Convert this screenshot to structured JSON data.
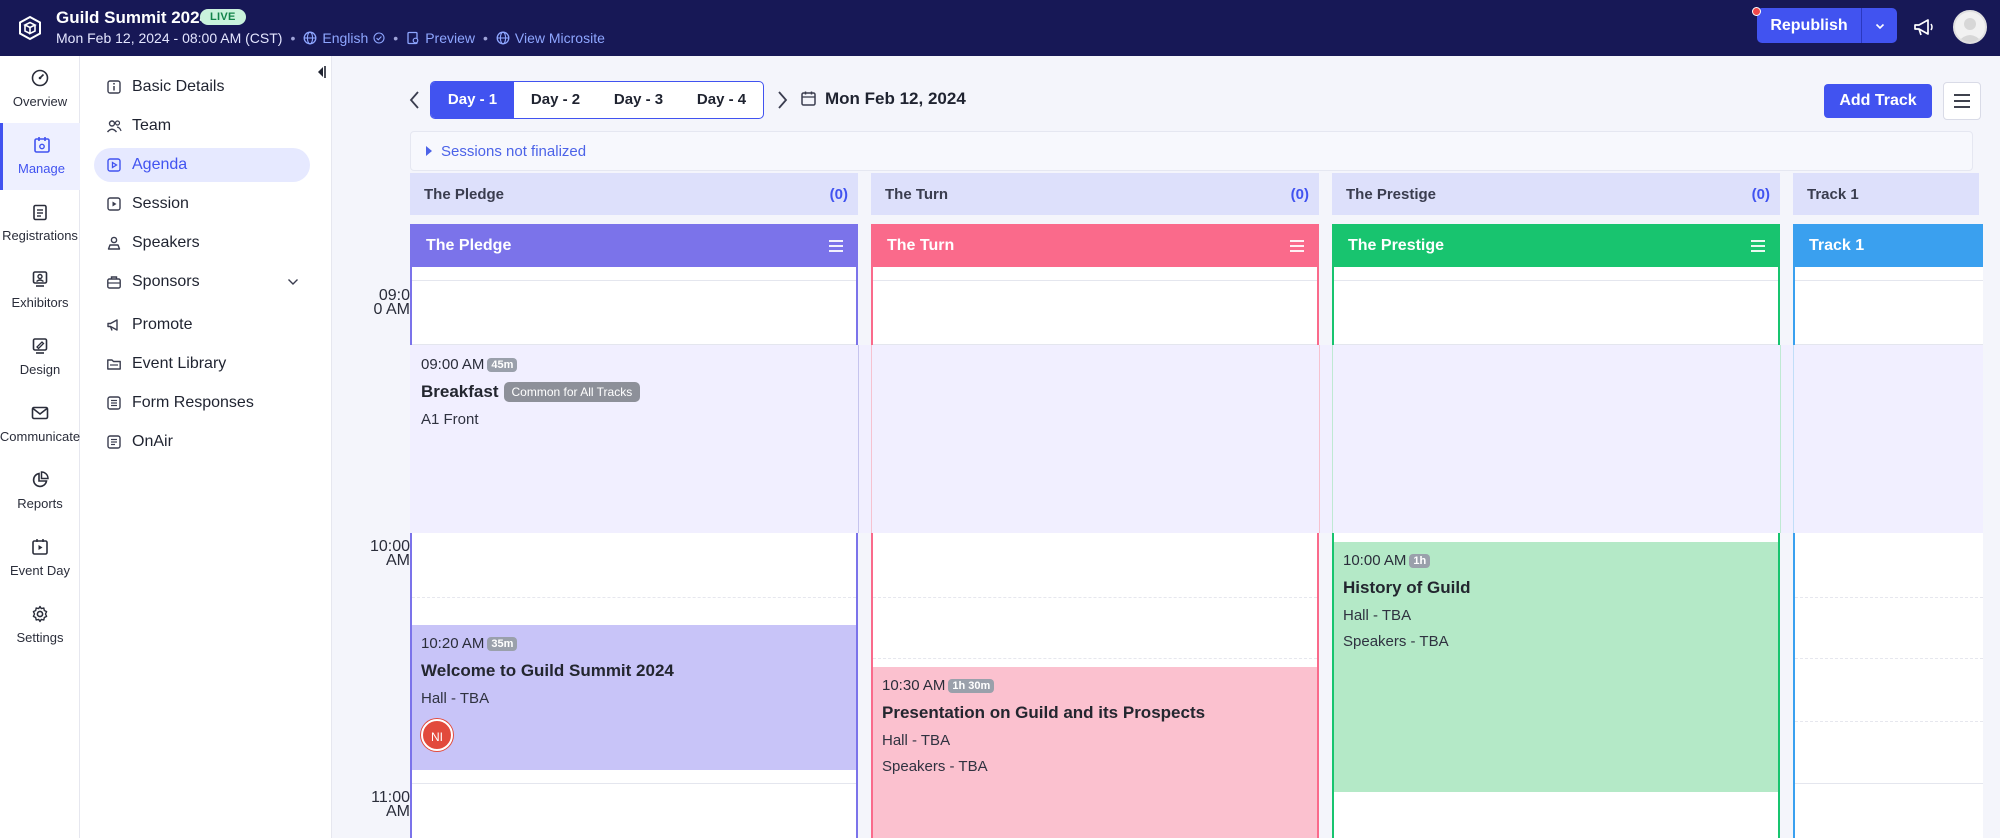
{
  "header": {
    "event_title": "Guild Summit 2024",
    "live_badge": "LIVE",
    "datetime": "Mon Feb 12, 2024 - 08:00 AM (CST)",
    "language": "English",
    "preview": "Preview",
    "view_microsite": "View Microsite",
    "republish": "Republish"
  },
  "rail": {
    "items": [
      {
        "label": "Overview",
        "icon": "gauge-icon"
      },
      {
        "label": "Manage",
        "icon": "calendar-cog-icon",
        "active": true
      },
      {
        "label": "Registrations",
        "icon": "clipboard-icon"
      },
      {
        "label": "Exhibitors",
        "icon": "exhibitor-icon"
      },
      {
        "label": "Design",
        "icon": "palette-icon"
      },
      {
        "label": "Communicate",
        "icon": "mail-icon"
      },
      {
        "label": "Reports",
        "icon": "pie-chart-icon"
      },
      {
        "label": "Event Day",
        "icon": "play-icon"
      },
      {
        "label": "Settings",
        "icon": "gear-icon"
      }
    ]
  },
  "submenu": {
    "items": [
      {
        "label": "Basic Details",
        "icon": "info-icon"
      },
      {
        "label": "Team",
        "icon": "people-icon"
      },
      {
        "label": "Agenda",
        "icon": "agenda-icon",
        "active": true
      },
      {
        "label": "Session",
        "icon": "session-icon"
      },
      {
        "label": "Speakers",
        "icon": "speaker-icon"
      },
      {
        "label": "Sponsors",
        "icon": "briefcase-icon"
      },
      {
        "label": "Promote",
        "icon": "megaphone-icon"
      },
      {
        "label": "Event Library",
        "icon": "folder-icon"
      },
      {
        "label": "Form Responses",
        "icon": "form-icon"
      },
      {
        "label": "OnAir",
        "icon": "broadcast-icon"
      }
    ]
  },
  "agenda": {
    "day_tabs": [
      "Day - 1",
      "Day - 2",
      "Day - 3",
      "Day - 4"
    ],
    "active_day": "Day - 1",
    "date": "Mon Feb 12, 2024",
    "add_track": "Add Track",
    "unfinalized": "Sessions not finalized",
    "tracks": [
      {
        "name": "The Pledge",
        "count": "(0)",
        "color": "#7b73ea"
      },
      {
        "name": "The Turn",
        "count": "(0)",
        "color": "#fa6a8b"
      },
      {
        "name": "The Prestige",
        "count": "(0)",
        "color": "#18c46f"
      },
      {
        "name": "Track 1",
        "count": "",
        "color": "#3aa0ef"
      }
    ],
    "time_labels": [
      {
        "line1": "09:0",
        "line2": "0 AM"
      },
      {
        "line1": "10:00",
        "line2": "AM"
      },
      {
        "line1": "11:00",
        "line2": "AM"
      }
    ],
    "events": [
      {
        "time": "09:00 AM",
        "duration": "45m",
        "title": "Breakfast",
        "tag": "Common for All Tracks",
        "location": "A1 Front"
      },
      {
        "time": "10:20 AM",
        "duration": "35m",
        "title": "Welcome to Guild Summit 2024",
        "location": "Hall - TBA",
        "avatar": "NI"
      },
      {
        "time": "10:30 AM",
        "duration": "1h 30m",
        "title": "Presentation on Guild and its Prospects",
        "location": "Hall - TBA",
        "speakers": "Speakers - TBA"
      },
      {
        "time": "10:00 AM",
        "duration": "1h",
        "title": "History of Guild",
        "location": "Hall - TBA",
        "speakers": "Speakers - TBA"
      }
    ]
  }
}
